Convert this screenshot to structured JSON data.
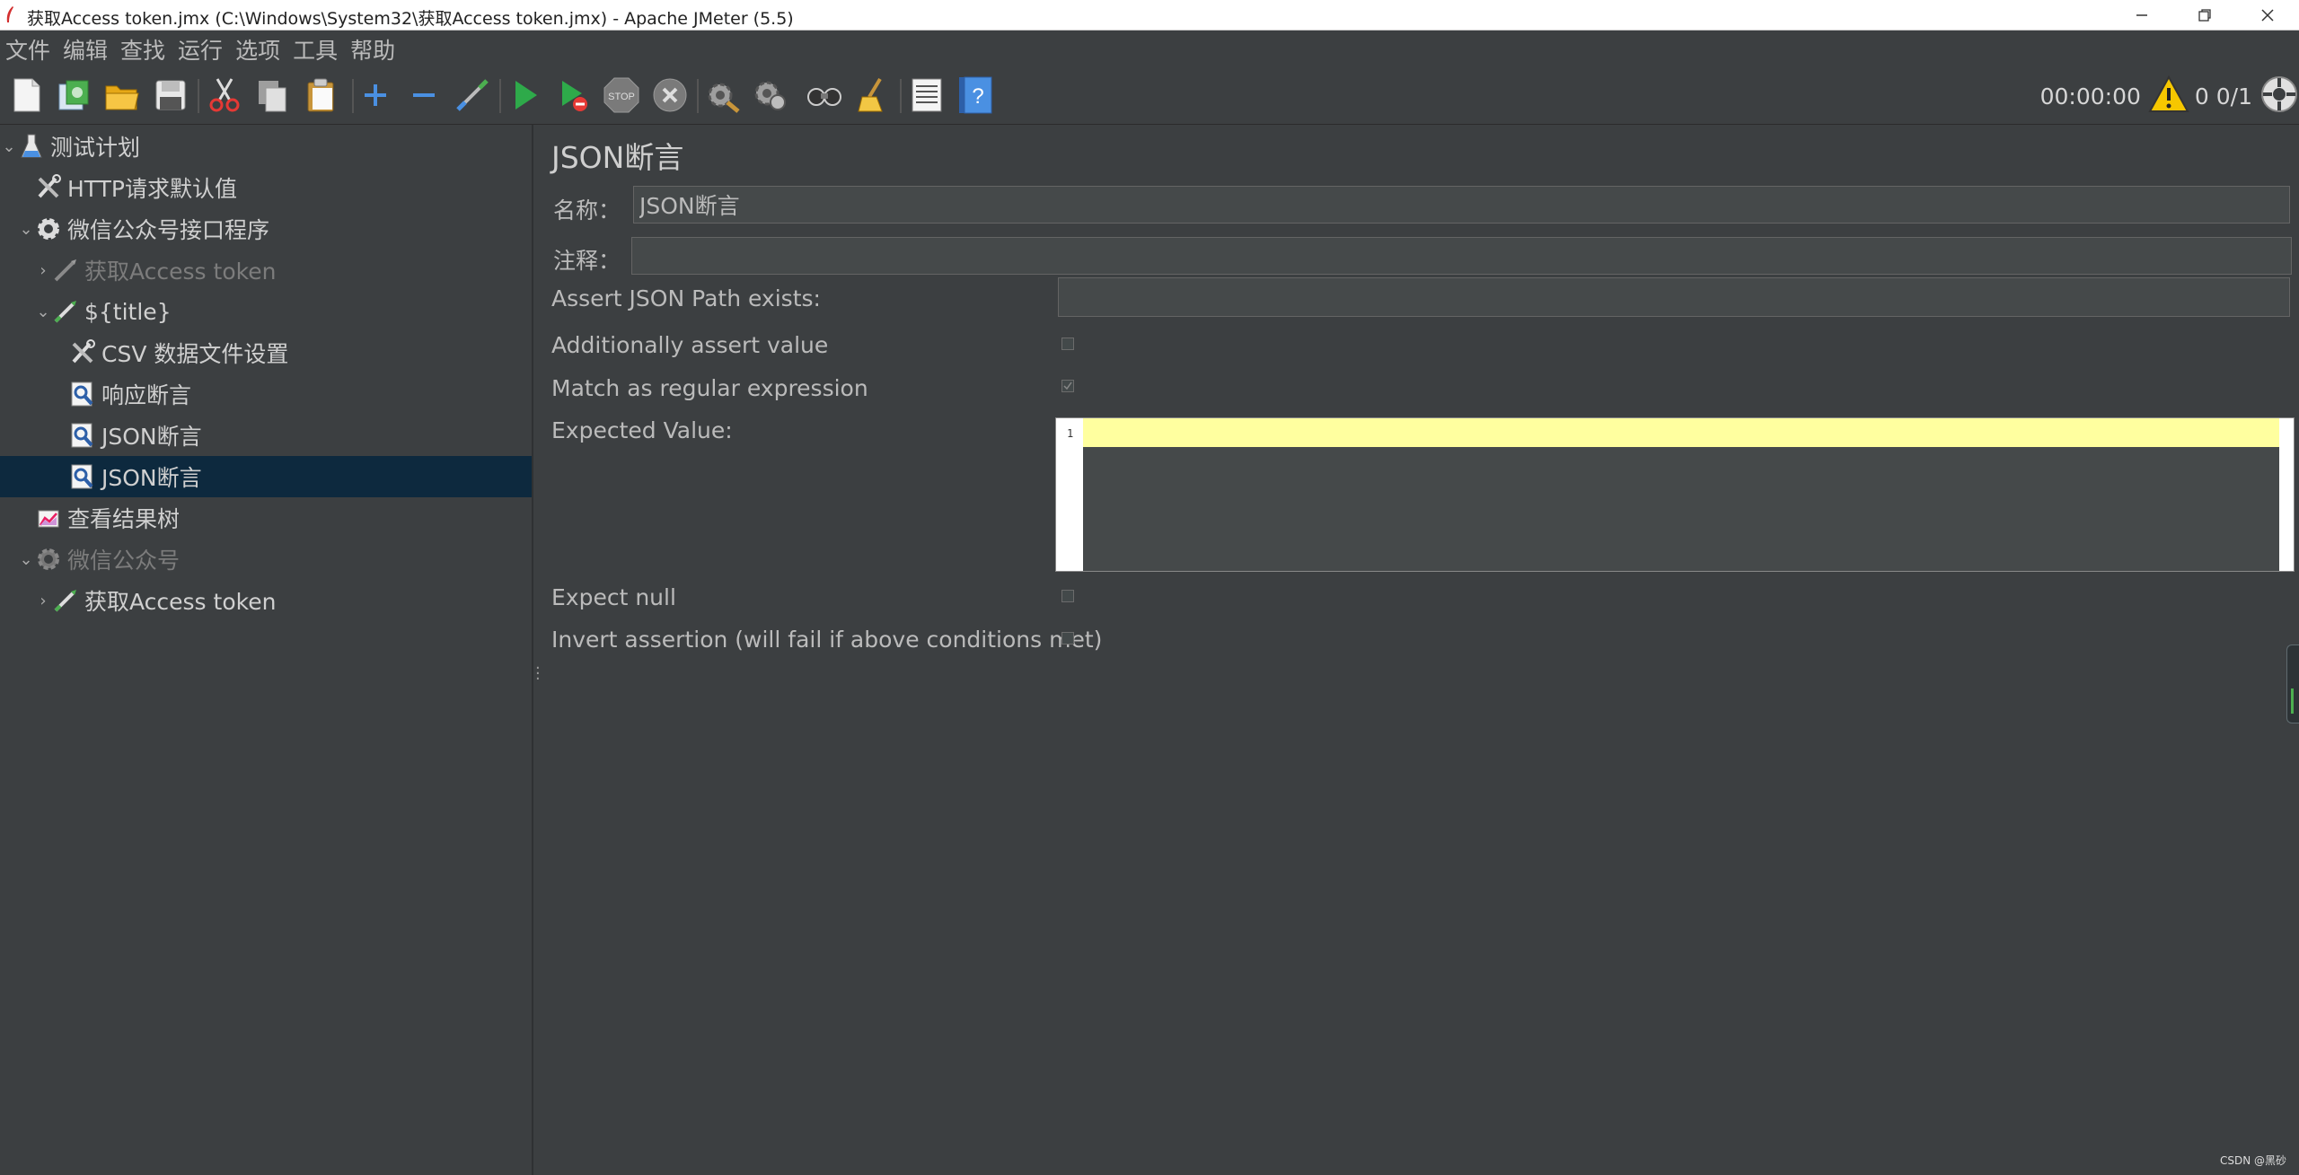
{
  "window": {
    "title": "获取Access token.jmx (C:\\Windows\\System32\\获取Access token.jmx) - Apache JMeter (5.5)"
  },
  "menu": [
    "文件",
    "编辑",
    "查找",
    "运行",
    "选项",
    "工具",
    "帮助"
  ],
  "toolbar": {
    "buttons": [
      "new-icon",
      "templates-icon",
      "open-icon",
      "save-icon",
      "cut-icon",
      "copy-icon",
      "paste-icon",
      "expand-icon",
      "collapse-icon",
      "toggle-icon",
      "start-icon",
      "start-no-pause-icon",
      "stop-icon",
      "shutdown-icon",
      "clear-icon",
      "clear-all-icon",
      "search-icon",
      "reset-search-icon",
      "function-helper-icon",
      "help-icon"
    ],
    "timer": "00:00:00",
    "counter": "0 0/1"
  },
  "tree": [
    {
      "label": "测试计划",
      "icon": "test-plan-icon",
      "chevron": "⌄",
      "indent": 0,
      "selected": false,
      "disabled": false
    },
    {
      "label": "HTTP请求默认值",
      "icon": "config-element-icon",
      "chevron": "",
      "indent": 1,
      "selected": false,
      "disabled": false
    },
    {
      "label": "微信公众号接口程序",
      "icon": "thread-group-icon",
      "chevron": "⌄",
      "indent": 1,
      "selected": false,
      "disabled": false
    },
    {
      "label": "获取Access token",
      "icon": "sampler-icon",
      "chevron": "›",
      "indent": 2,
      "selected": false,
      "disabled": true
    },
    {
      "label": "${title}",
      "icon": "sampler-icon",
      "chevron": "⌄",
      "indent": 2,
      "selected": false,
      "disabled": false
    },
    {
      "label": "CSV 数据文件设置",
      "icon": "config-element-icon",
      "chevron": "",
      "indent": 3,
      "selected": false,
      "disabled": false
    },
    {
      "label": "响应断言",
      "icon": "assertion-icon",
      "chevron": "",
      "indent": 3,
      "selected": false,
      "disabled": false
    },
    {
      "label": "JSON断言",
      "icon": "assertion-icon",
      "chevron": "",
      "indent": 3,
      "selected": false,
      "disabled": false
    },
    {
      "label": "JSON断言",
      "icon": "assertion-icon",
      "chevron": "",
      "indent": 3,
      "selected": true,
      "disabled": false
    },
    {
      "label": "查看结果树",
      "icon": "listener-icon",
      "chevron": "",
      "indent": 1,
      "selected": false,
      "disabled": false
    },
    {
      "label": "微信公众号",
      "icon": "thread-group-icon",
      "chevron": "⌄",
      "indent": 1,
      "selected": false,
      "disabled": true
    },
    {
      "label": "获取Access token",
      "icon": "sampler-icon",
      "chevron": "›",
      "indent": 2,
      "selected": false,
      "disabled": false
    }
  ],
  "form": {
    "title": "JSON断言",
    "name_label": "名称：",
    "name_value": "JSON断言",
    "comment_label": "注释：",
    "comment_value": "",
    "path_label": "Assert JSON Path exists:",
    "path_value": "",
    "additionally_label": "Additionally assert value",
    "additionally_checked": false,
    "regex_label": "Match as regular expression",
    "regex_checked": true,
    "expected_label": "Expected Value:",
    "editor_line_number": "1",
    "expected_value": "",
    "expect_null_label": "Expect null",
    "expect_null_checked": false,
    "invert_label": "Invert assertion (will fail if above conditions met)",
    "invert_checked": false
  },
  "watermark": "CSDN @黑砂"
}
